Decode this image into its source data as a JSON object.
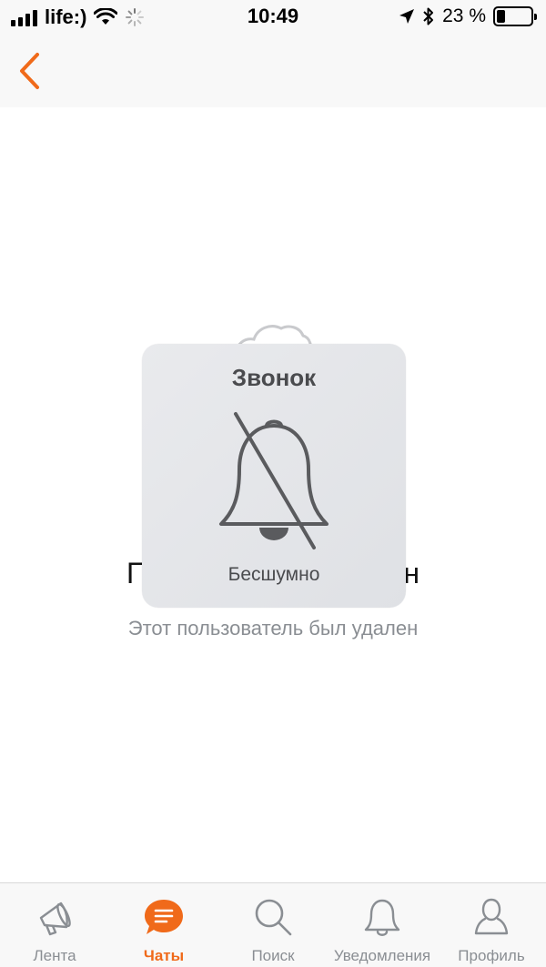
{
  "status_bar": {
    "carrier": "life:)",
    "time": "10:49",
    "battery_percent": "23 %",
    "battery_level": 0.23
  },
  "nav_bar": {
    "back_icon": "chevron-left-icon"
  },
  "content": {
    "title": "Пользователь удален",
    "subtitle": "Этот пользователь был удален",
    "placeholder_icon": "cloud-icon"
  },
  "hud": {
    "title": "Звонок",
    "label": "Бесшумно",
    "icon": "bell-slash-icon"
  },
  "tabs": [
    {
      "label": "Лента",
      "icon": "megaphone-icon",
      "active": false
    },
    {
      "label": "Чаты",
      "icon": "chat-bubble-icon",
      "active": true
    },
    {
      "label": "Поиск",
      "icon": "search-icon",
      "active": false
    },
    {
      "label": "Уведомления",
      "icon": "bell-icon",
      "active": false
    },
    {
      "label": "Профиль",
      "icon": "person-icon",
      "active": false
    }
  ],
  "colors": {
    "accent": "#f06a1a",
    "inactive": "#8a8e93",
    "bar_bg": "#f8f8f8",
    "hud_bg": "#e4e5e8"
  }
}
